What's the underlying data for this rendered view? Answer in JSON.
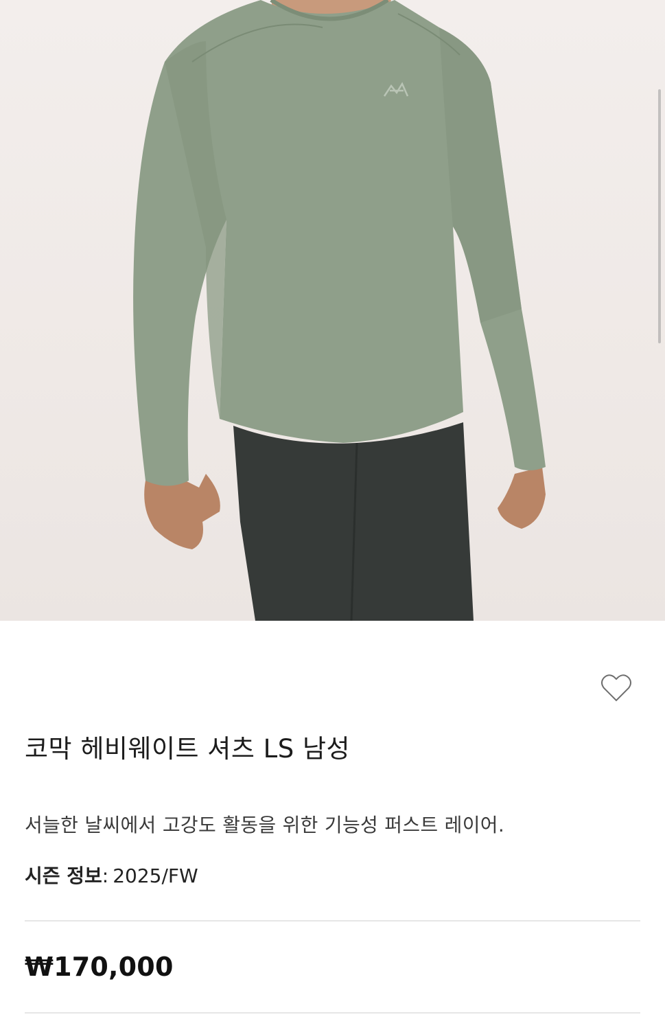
{
  "product": {
    "image_alt": "코막 헤비웨이트 셔츠 LS 남성",
    "title": "코막 헤비웨이트 셔츠 LS 남성",
    "description": "서늘한 날씨에서 고강도 활동을 위한 기능성 퍼스트 레이어.",
    "season_label": "시즌 정보",
    "season_separator": ":",
    "season_value": "2025/FW",
    "price": "₩170,000"
  },
  "icons": {
    "wishlist": "heart-outline-icon"
  },
  "colors": {
    "shirt": "#8f9f8a",
    "pants": "#363a38",
    "background": "#efe9e6",
    "divider": "#e6e6e6",
    "text": "#1c1c1c"
  }
}
